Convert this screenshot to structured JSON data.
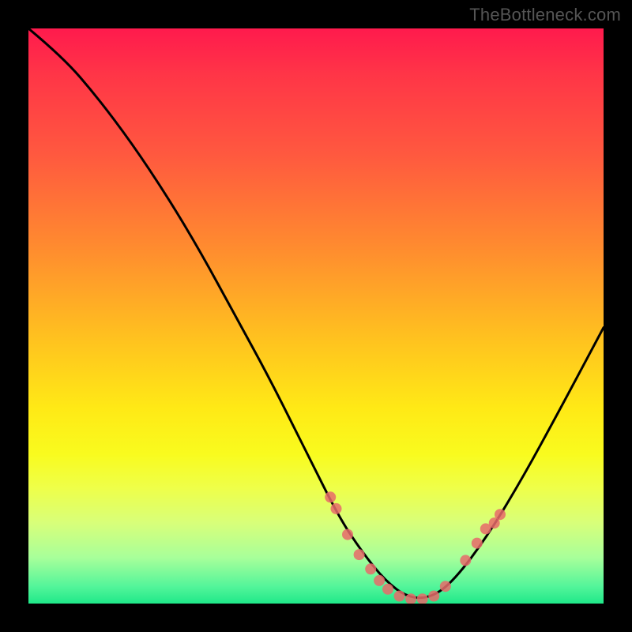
{
  "watermark": "TheBottleneck.com",
  "chart_data": {
    "type": "line",
    "title": "",
    "xlabel": "",
    "ylabel": "",
    "xlim": [
      0,
      100
    ],
    "ylim": [
      0,
      100
    ],
    "series": [
      {
        "name": "bottleneck-curve",
        "x": [
          0,
          6,
          12,
          18,
          24,
          30,
          36,
          42,
          48,
          54,
          58,
          62,
          66,
          70,
          74,
          80,
          86,
          92,
          100
        ],
        "y": [
          100,
          95,
          88,
          80,
          71,
          61,
          50,
          39,
          27,
          15,
          9,
          4,
          1,
          1,
          4,
          12,
          22,
          33,
          48
        ]
      }
    ],
    "markers": {
      "name": "highlight-points",
      "x": [
        52.5,
        53.5,
        55.5,
        57.5,
        59.5,
        61.0,
        62.5,
        64.5,
        66.5,
        68.5,
        70.5,
        72.5,
        76.0,
        78.0,
        79.5,
        81.0,
        82.0
      ],
      "y": [
        18.5,
        16.5,
        12.0,
        8.5,
        6.0,
        4.0,
        2.5,
        1.3,
        0.8,
        0.8,
        1.3,
        3.0,
        7.5,
        10.5,
        13.0,
        14.0,
        15.5
      ]
    }
  }
}
